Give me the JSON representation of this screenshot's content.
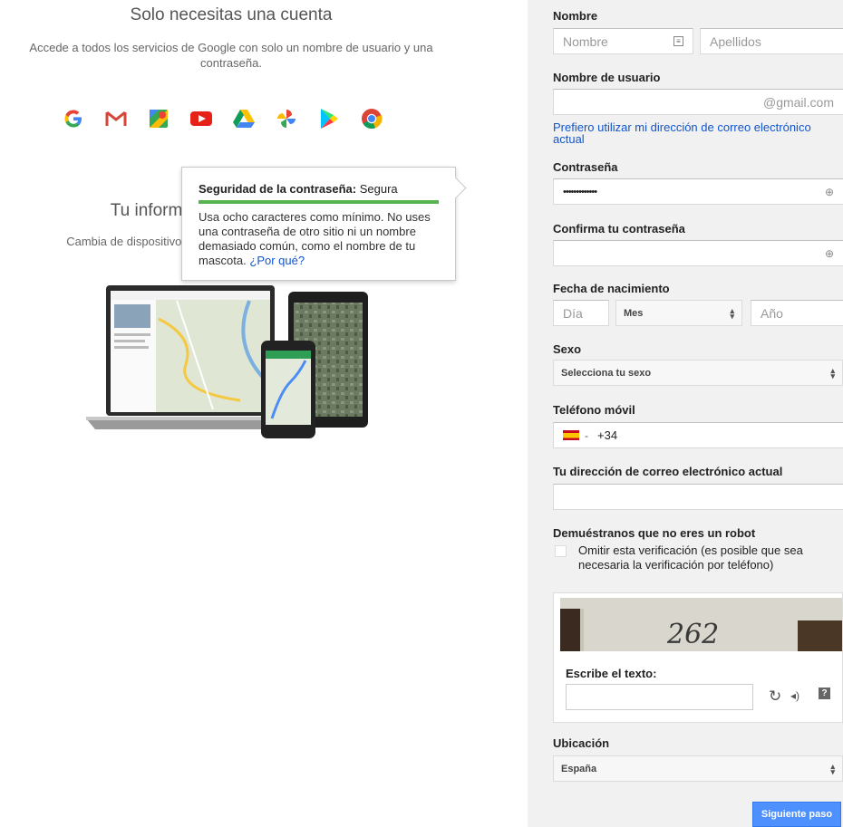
{
  "intro": {
    "title": "Solo necesitas una cuenta",
    "subtitle": "Accede a todos los servicios de Google con solo un nombre de usuario y una contraseña."
  },
  "logos": [
    "google-g-icon",
    "gmail-icon",
    "maps-icon",
    "youtube-icon",
    "drive-icon",
    "photos-icon",
    "play-icon",
    "chrome-icon"
  ],
  "info": {
    "title": "Tu información, en todas partes",
    "subtitle": "Cambia de dispositivo y continúa justo donde lo habías dejado."
  },
  "password_tooltip": {
    "label": "Seguridad de la contraseña:",
    "strength": "Segura",
    "strength_color": "#56b350",
    "body": "Usa ocho caracteres como mínimo. No uses una contraseña de otro sitio ni un nombre demasiado común, como el nombre de tu mascota.",
    "link": "¿Por qué?"
  },
  "form": {
    "name": {
      "label": "Nombre",
      "first_placeholder": "Nombre",
      "last_placeholder": "Apellidos"
    },
    "username": {
      "label": "Nombre de usuario",
      "suffix": "@gmail.com",
      "alt_link": "Prefiero utilizar mi dirección de correo electrónico actual"
    },
    "password": {
      "label": "Contraseña",
      "value": "•••••••••••••"
    },
    "confirm_password": {
      "label": "Confirma tu contraseña",
      "value": ""
    },
    "birthdate": {
      "label": "Fecha de nacimiento",
      "day_placeholder": "Día",
      "month_value": "Mes",
      "year_placeholder": "Año"
    },
    "gender": {
      "label": "Sexo",
      "value": "Selecciona tu sexo"
    },
    "phone": {
      "label": "Teléfono móvil",
      "prefix": "+34",
      "separator": "-"
    },
    "current_email": {
      "label": "Tu dirección de correo electrónico actual",
      "value": ""
    },
    "robot": {
      "label": "Demuéstranos que no eres un robot",
      "skip_label": "Omitir esta verificación (es posible que sea necesaria la verificación por teléfono)",
      "captcha_text_label": "Escribe el texto:"
    },
    "location": {
      "label": "Ubicación",
      "value": "España"
    },
    "next_button": "Siguiente paso"
  }
}
